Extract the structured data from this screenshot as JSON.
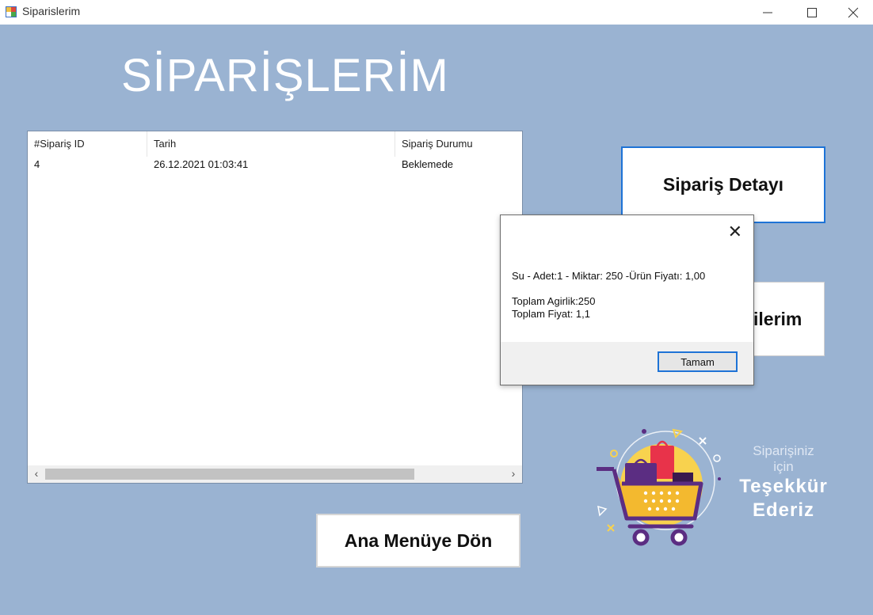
{
  "window": {
    "title": "Siparislerim"
  },
  "page": {
    "heading": "SİPARİŞLERİM"
  },
  "orders": {
    "columns": [
      "#Sipariş ID",
      "Tarih",
      "Sipariş Durumu"
    ],
    "rows": [
      {
        "id": "4",
        "date": "26.12.2021 01:03:41",
        "status": "Beklemede"
      }
    ]
  },
  "buttons": {
    "detail": "Sipariş Detayı",
    "hidden_partial": "ilerim",
    "main_menu": "Ana Menüye Dön"
  },
  "dialog": {
    "line1": "Su - Adet:1 - Miktar: 250 -Ürün Fiyatı: 1,00",
    "line2": "Toplam Agirlik:250",
    "line3": "Toplam Fiyat: 1,1",
    "ok": "Tamam"
  },
  "thanks": {
    "line1": "Siparişiniz",
    "line2": "için",
    "line3": "Teşekkür",
    "line4": "Ederiz"
  }
}
